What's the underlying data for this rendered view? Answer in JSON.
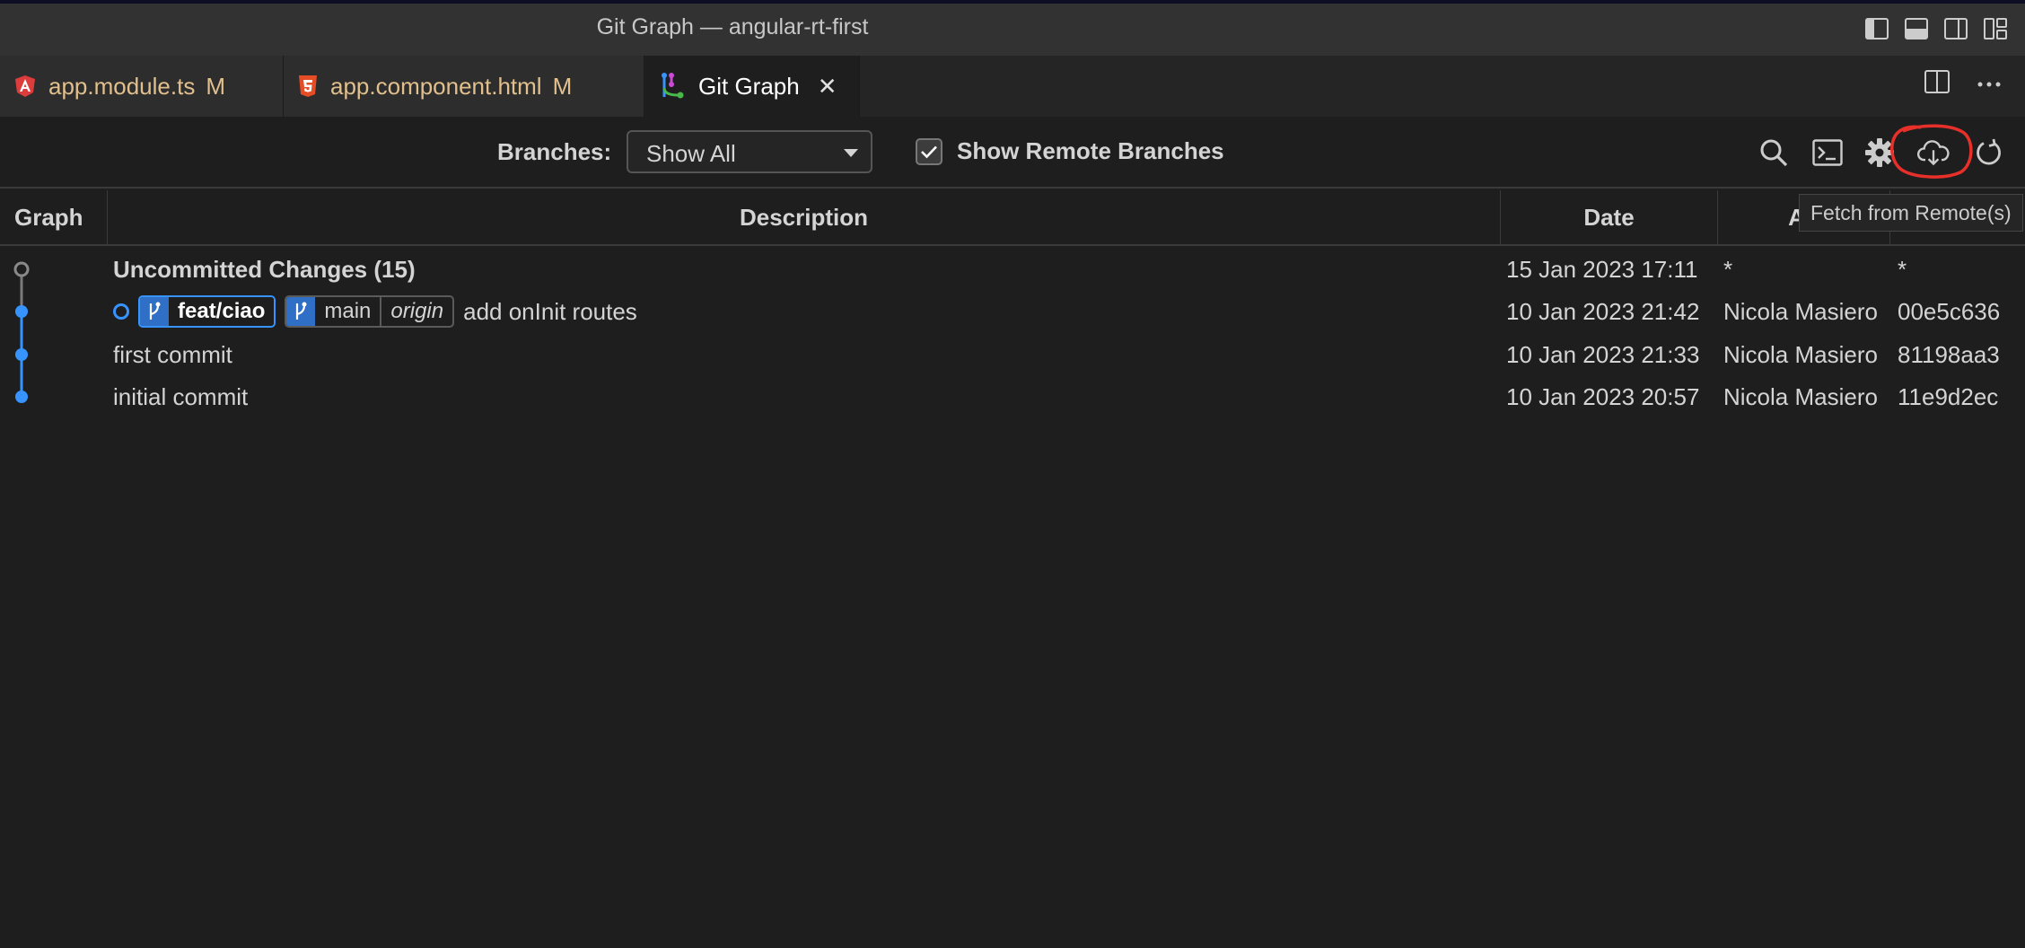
{
  "window": {
    "title": "Git Graph — angular-rt-first"
  },
  "tabs": [
    {
      "label": "app.module.ts",
      "status": "M",
      "icon": "angular-icon"
    },
    {
      "label": "app.component.html",
      "status": "M",
      "icon": "html5-icon"
    },
    {
      "label": "Git Graph",
      "icon": "git-graph-icon",
      "close": "✕"
    }
  ],
  "controls": {
    "branches_label": "Branches:",
    "branches_value": "Show All",
    "show_remote_label": "Show Remote Branches",
    "show_remote_checked": true
  },
  "table": {
    "headers": {
      "graph": "Graph",
      "description": "Description",
      "date": "Date",
      "author": "Au",
      "commit": ""
    },
    "rows": [
      {
        "description": "Uncommitted Changes (15)",
        "date": "15 Jan 2023 17:11",
        "author": "*",
        "commit": "*"
      },
      {
        "branch": "feat/ciao",
        "branch2": "main",
        "remote": "origin",
        "description": "add onInit routes",
        "date": "10 Jan 2023 21:42",
        "author": "Nicola Masiero",
        "commit": "00e5c636"
      },
      {
        "description": "first commit",
        "date": "10 Jan 2023 21:33",
        "author": "Nicola Masiero",
        "commit": "81198aa3"
      },
      {
        "description": "initial commit",
        "date": "10 Jan 2023 20:57",
        "author": "Nicola Masiero",
        "commit": "11e9d2ec"
      }
    ]
  },
  "tooltip": "Fetch from Remote(s)",
  "colors": {
    "accent": "#3794ff",
    "modified": "#e2c08d",
    "annotation": "#e8302a"
  }
}
